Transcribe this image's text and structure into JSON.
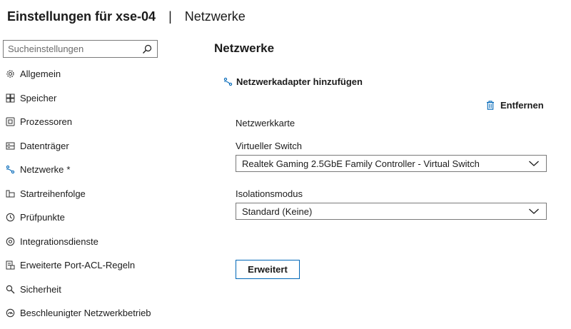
{
  "header": {
    "title": "Einstellungen für xse-04",
    "separator": "|",
    "subtitle": "Netzwerke"
  },
  "search": {
    "placeholder": "Sucheinstellungen",
    "value": ""
  },
  "sidebar": {
    "items": [
      {
        "label": "Allgemein",
        "icon": "gear-icon"
      },
      {
        "label": "Speicher",
        "icon": "memory-icon"
      },
      {
        "label": "Prozessoren",
        "icon": "processor-icon"
      },
      {
        "label": "Datenträger",
        "icon": "disk-icon"
      },
      {
        "label": "Netzwerke",
        "icon": "network-icon",
        "active": true,
        "marker": "*"
      },
      {
        "label": "Startreihenfolge",
        "icon": "boot-order-icon"
      },
      {
        "label": "Prüfpunkte",
        "icon": "checkpoint-icon"
      },
      {
        "label": "Integrationsdienste",
        "icon": "integration-icon"
      },
      {
        "label": "Erweiterte Port-ACL-Regeln",
        "icon": "port-acl-icon"
      },
      {
        "label": "Sicherheit",
        "icon": "security-icon"
      },
      {
        "label": "Beschleunigter Netzwerkbetrieb",
        "icon": "accelerated-network-icon"
      }
    ]
  },
  "main": {
    "section_title": "Netzwerke",
    "add_adapter_label": "Netzwerkadapter hinzufügen",
    "remove_label": "Entfernen",
    "card_label": "Netzwerkkarte",
    "vswitch_label": "Virtueller Switch",
    "vswitch_value": "Realtek Gaming 2.5GbE Family Controller - Virtual Switch",
    "isolation_label": "Isolationsmodus",
    "isolation_value": "Standard (Keine)",
    "advanced_button": "Erweitert"
  },
  "colors": {
    "accent": "#0067b8",
    "text": "#1b1b1b",
    "border": "#7a7a7a"
  }
}
